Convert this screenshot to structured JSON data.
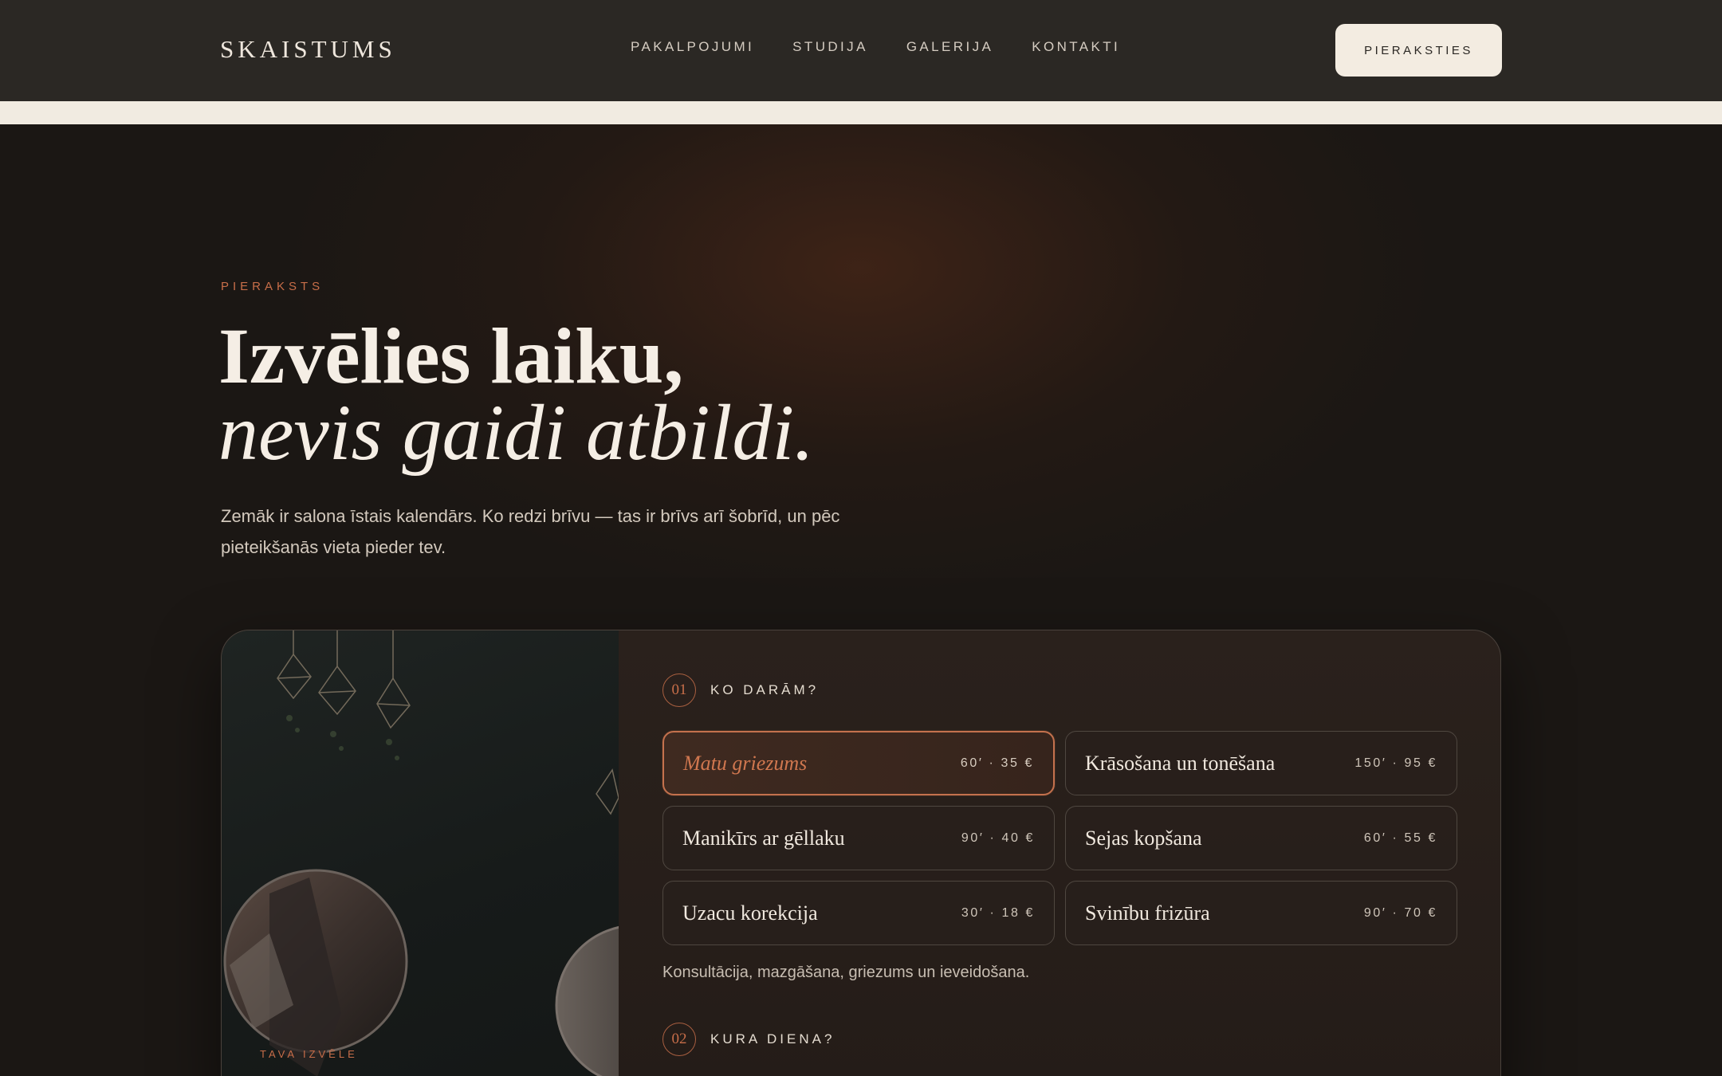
{
  "header": {
    "logo": "SKAISTUMS",
    "nav": [
      "PAKALPOJUMI",
      "STUDIJA",
      "GALERIJA",
      "KONTAKTI"
    ],
    "cta": "PIERAKSTIES"
  },
  "hero": {
    "eyebrow": "PIERAKSTS",
    "headline_line1": "Izvēlies laiku,",
    "headline_line2": "nevis gaidi atbildi.",
    "lead": "Zemāk ir salona īstais kalendārs. Ko redzi brīvu — tas ir brīvs arī šobrīd, un pēc pieteikšanās vieta pieder tev."
  },
  "booking": {
    "photo_caption": "TAVA IZVĒLE",
    "step1": {
      "number": "01",
      "label": "KO DARĀM?"
    },
    "services": [
      {
        "name": "Matu griezums",
        "meta": "60′ · 35 €",
        "selected": true
      },
      {
        "name": "Krāsošana un tonēšana",
        "meta": "150′ · 95 €",
        "selected": false
      },
      {
        "name": "Manikīrs ar gēllaku",
        "meta": "90′ · 40 €",
        "selected": false
      },
      {
        "name": "Sejas kopšana",
        "meta": "60′ · 55 €",
        "selected": false
      },
      {
        "name": "Uzacu korekcija",
        "meta": "30′ · 18 €",
        "selected": false
      },
      {
        "name": "Svinību frizūra",
        "meta": "90′ · 70 €",
        "selected": false
      }
    ],
    "service_description": "Konsultācija, mazgāšana, griezums un ieveidošana.",
    "step2": {
      "number": "02",
      "label": "KURA DIENA?"
    }
  },
  "colors": {
    "accent": "#c86e49",
    "header_bg": "#2b2824",
    "page_bg": "#1b1714",
    "cream": "#f1ebe1"
  }
}
